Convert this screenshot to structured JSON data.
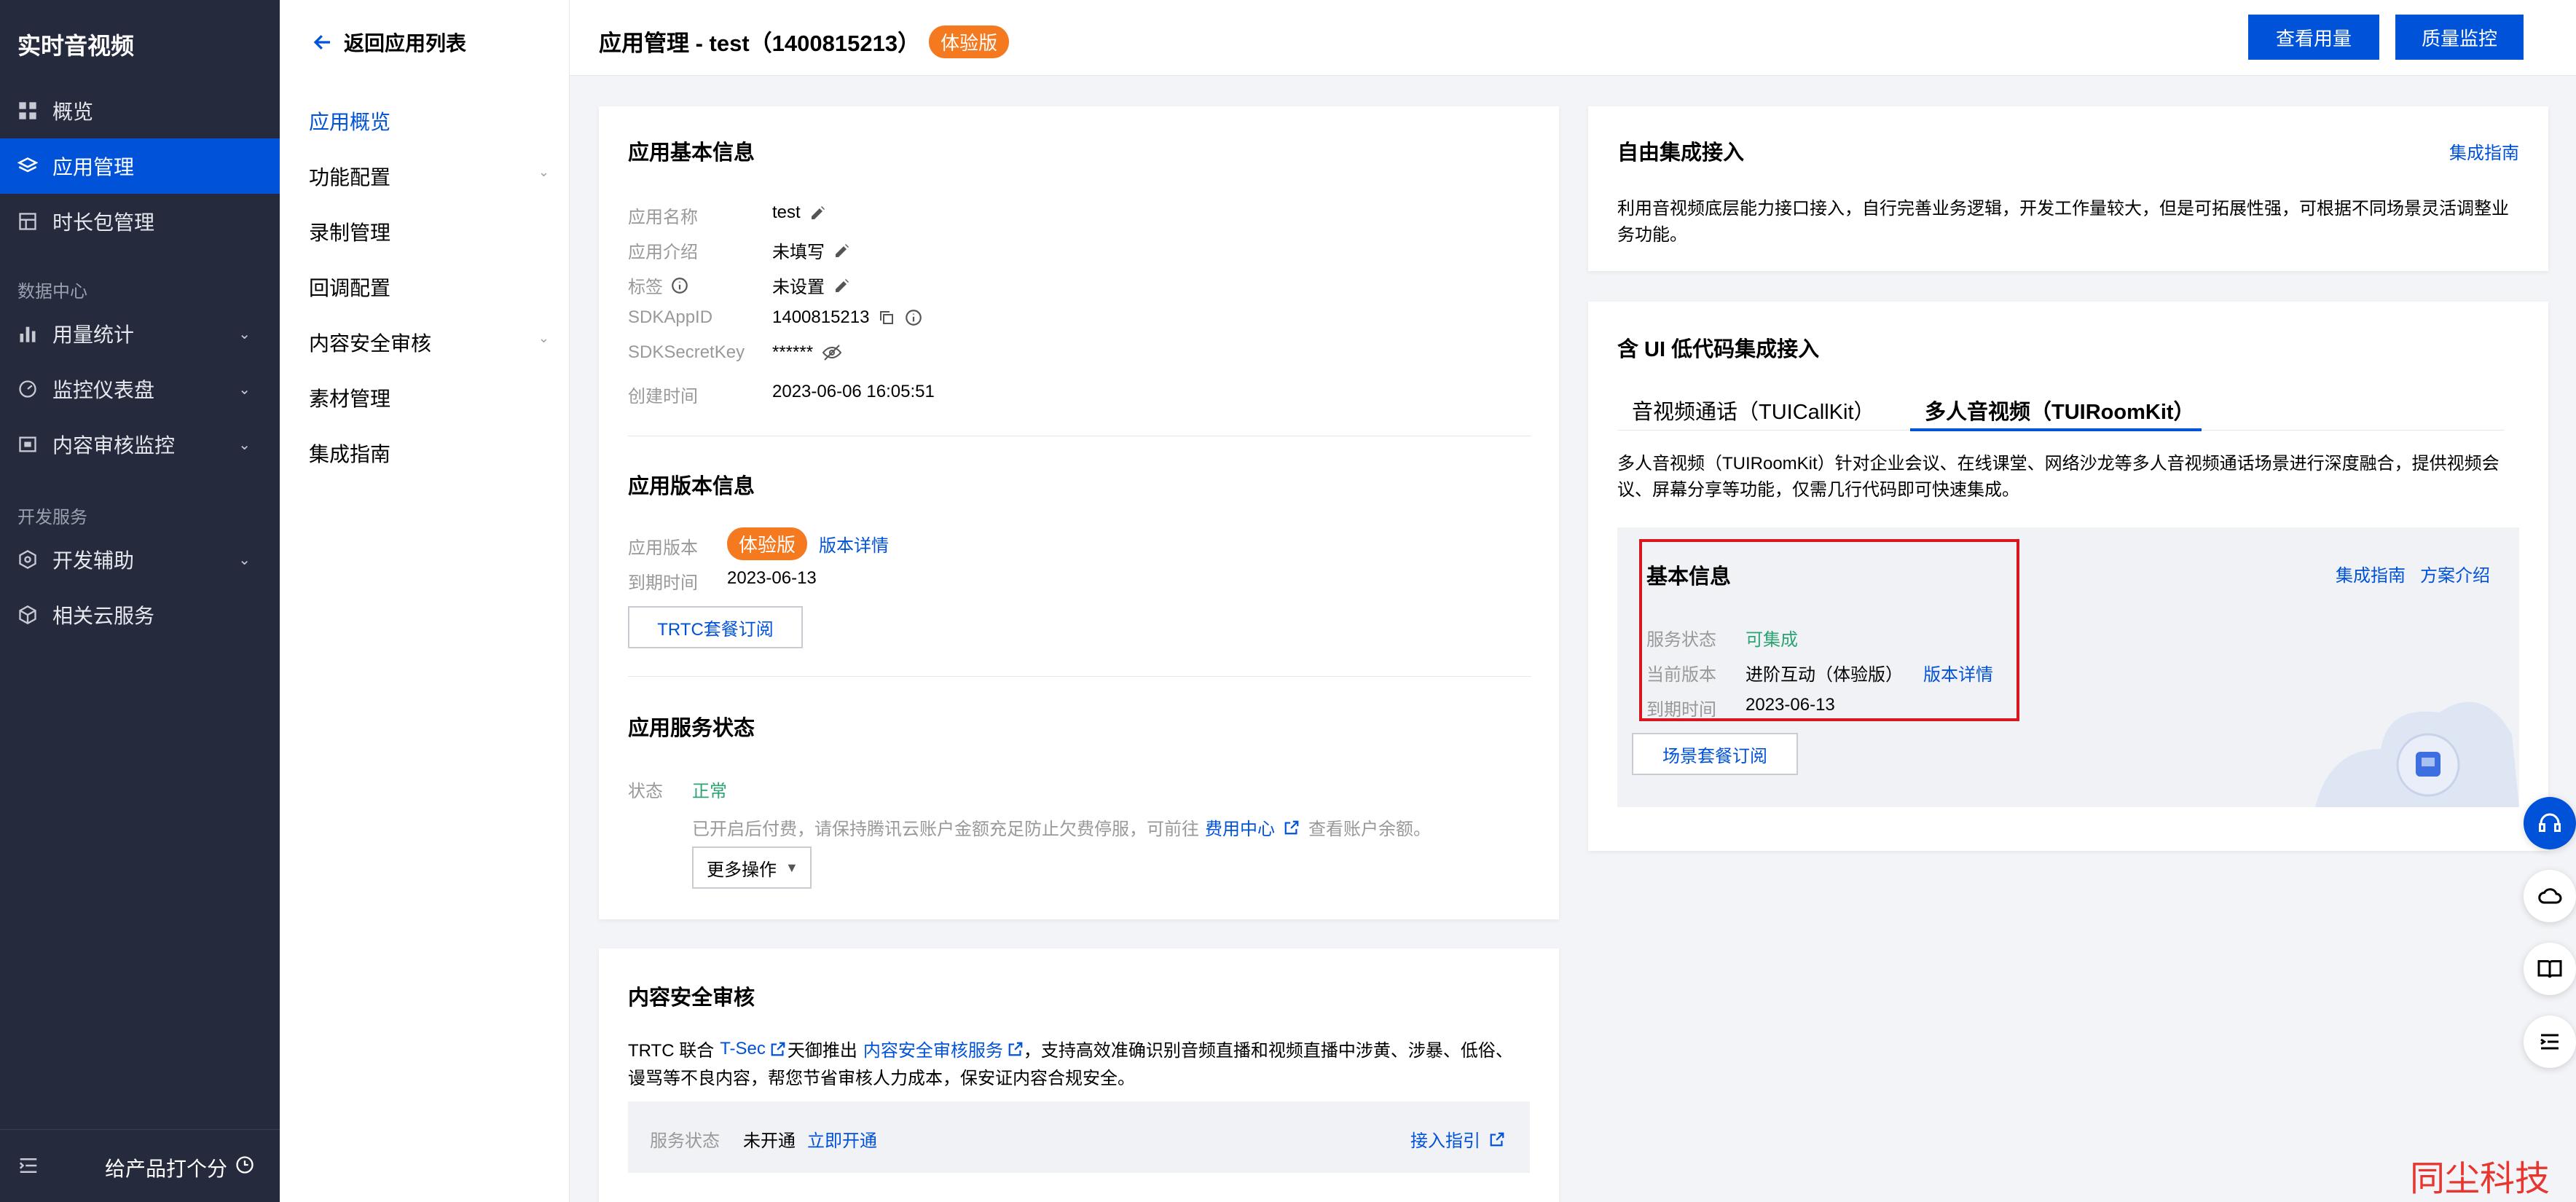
{
  "nav": {
    "title": "实时音视频",
    "items": [
      {
        "label": "概览",
        "icon": "grid-icon"
      },
      {
        "label": "应用管理",
        "icon": "layers-icon",
        "active": true
      },
      {
        "label": "时长包管理",
        "icon": "package-icon"
      }
    ],
    "group_data": "数据中心",
    "data_items": [
      {
        "label": "用量统计",
        "icon": "bar-chart-icon"
      },
      {
        "label": "监控仪表盘",
        "icon": "gauge-icon"
      },
      {
        "label": "内容审核监控",
        "icon": "monitor-icon"
      }
    ],
    "group_dev": "开发服务",
    "dev_items": [
      {
        "label": "开发辅助",
        "icon": "hexagon-icon"
      },
      {
        "label": "相关云服务",
        "icon": "cube-icon"
      }
    ],
    "rate_label": "给产品打个分"
  },
  "subnav": {
    "back_label": "返回应用列表",
    "items": [
      "应用概览",
      "功能配置",
      "录制管理",
      "回调配置",
      "内容安全审核",
      "素材管理",
      "集成指南"
    ]
  },
  "header": {
    "title": "应用管理 - test（1400815213）",
    "badge": "体验版",
    "btn_usage": "查看用量",
    "btn_quality": "质量监控"
  },
  "basic_info": {
    "title": "应用基本信息",
    "rows": [
      {
        "label": "应用名称",
        "value": "test"
      },
      {
        "label": "应用介绍",
        "value": "未填写"
      },
      {
        "label": "标签",
        "value": "未设置"
      },
      {
        "label": "SDKAppID",
        "value": "1400815213"
      },
      {
        "label": "SDKSecretKey",
        "value": "******"
      },
      {
        "label": "创建时间",
        "value": "2023-06-06 16:05:51"
      }
    ]
  },
  "version_info": {
    "title": "应用版本信息",
    "version_label": "应用版本",
    "version_badge": "体验版",
    "version_link": "版本详情",
    "expire_label": "到期时间",
    "expire_value": "2023-06-13",
    "subscribe_btn": "TRTC套餐订阅"
  },
  "service_status": {
    "title": "应用服务状态",
    "status_label": "状态",
    "status_value": "正常",
    "note_before": "已开启后付费，请保持腾讯云账户金额充足防止欠费停服，可前往",
    "note_link": "费用中心",
    "note_after": "查看账户余额。",
    "more_btn": "更多操作"
  },
  "content_audit": {
    "title": "内容安全审核",
    "desc_1": "TRTC 联合",
    "link_tsec": "T-Sec",
    "desc_2": "天御推出",
    "link_service": "内容安全审核服务",
    "desc_3": "，支持高效准确识别音频直播和视频直播中涉黄、涉暴、低俗、",
    "desc_4": "谩骂等不良内容，帮您节省审核人力成本，保安证内容合规安全。",
    "status_label": "服务状态",
    "status_value": "未开通",
    "open_link": "立即开通",
    "guide_link": "接入指引"
  },
  "free_integration": {
    "title": "自由集成接入",
    "guide_link": "集成指南",
    "desc_1": "利用音视频底层能力接口接入，自行完善业务逻辑，开发工作量较大，但是可拓展性强，可根据不同场景灵活调整业",
    "desc_2": "务功能。"
  },
  "lowcode": {
    "title": "含 UI 低代码集成接入",
    "tabs": [
      "音视频通话（TUICallKit）",
      "多人音视频（TUIRoomKit）"
    ],
    "desc_1": "多人音视频（TUIRoomKit）针对企业会议、在线课堂、网络沙龙等多人音视频通话场景进行深度融合，提供视频会",
    "desc_2": "议、屏幕分享等功能，仅需几行代码即可快速集成。",
    "info_title": "基本信息",
    "link_guide": "集成指南",
    "link_plan": "方案介绍",
    "rows": [
      {
        "label": "服务状态",
        "value": "可集成"
      },
      {
        "label": "当前版本",
        "value": "进阶互动（体验版）"
      },
      {
        "label": "到期时间",
        "value": "2023-06-13"
      }
    ],
    "version_link": "版本详情",
    "subscribe_btn": "场景套餐订阅"
  },
  "watermark": "同尘科技",
  "colors": {
    "primary": "#0052d9",
    "badge": "#f4791f",
    "green": "#2ba471",
    "highlight": "#d9161d"
  }
}
